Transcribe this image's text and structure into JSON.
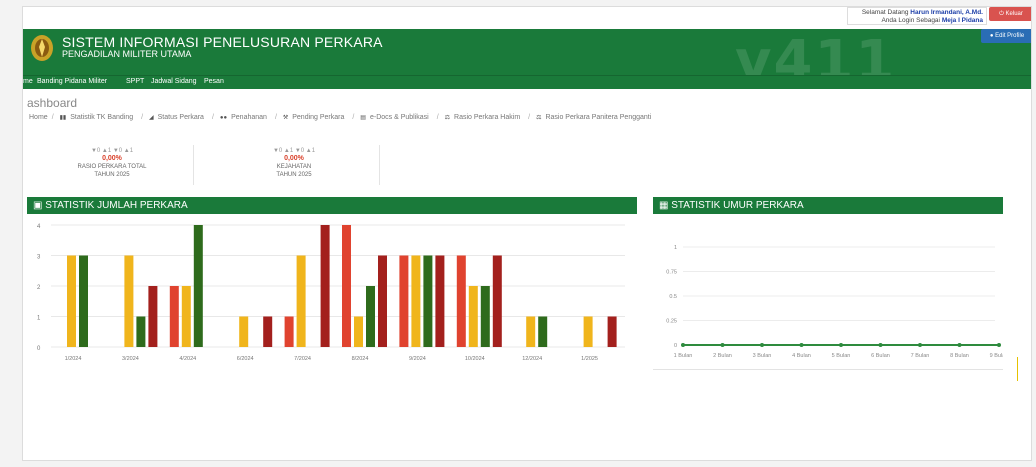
{
  "header": {
    "title": "SISTEM INFORMASI PENELUSURAN PERKARA",
    "subtitle": "PENGADILAN MILITER UTAMA",
    "watermark": "v411",
    "user_greeting": "Selamat Datang",
    "user_name": "Harun Irmandani, A.Md.",
    "login_as": "Anda Login Sebagai",
    "login_role": "Meja I Pidana",
    "logout_label": "Keluar",
    "profile_label": "Edit Profile"
  },
  "nav": {
    "items": [
      "me",
      "Banding Pidana Militer",
      "SPPT",
      "Jadwal Sidang",
      "Pesan"
    ]
  },
  "page": {
    "title": "ashboard",
    "breadcrumb": [
      "Home",
      "Statistik TK Banding",
      "Status Perkara",
      "Penahanan",
      "Pending Perkara",
      "e-Docs & Publikasi",
      "Rasio Perkara Hakim",
      "Rasio Perkara Panitera Pengganti"
    ]
  },
  "stats": [
    {
      "arrows": "▼0 ▲1 ▼0 ▲1",
      "pct": "0,00%",
      "label": "RASIO PERKARA TOTAL",
      "year": "TAHUN 2025"
    },
    {
      "arrows": "▼0 ▲1 ▼0 ▲1",
      "pct": "0,00%",
      "label": "KEJAHATAN",
      "year": "TAHUN 2025"
    }
  ],
  "panels": {
    "left_title": "STATISTIK JUMLAH PERKARA",
    "right_title": "STATISTIK UMUR PERKARA"
  },
  "colors": {
    "green_header": "#1a7a3a",
    "bar_red": "#e0432f",
    "bar_yellow": "#f0b51c",
    "bar_green": "#2e6b1c",
    "bar_darkred": "#a3201d"
  },
  "chart_data": [
    {
      "type": "bar",
      "title": "STATISTIK JUMLAH PERKARA",
      "ylim": [
        0,
        4
      ],
      "yticks": [
        "0",
        "1",
        "2",
        "3",
        "4"
      ],
      "grid": true,
      "series_colors": [
        "#e0432f",
        "#f0b51c",
        "#2e6b1c",
        "#a3201d"
      ],
      "groups": [
        {
          "label": "1/2024",
          "values": [
            null,
            3,
            3,
            null
          ]
        },
        {
          "label": "",
          "values": [
            null,
            3,
            1,
            2
          ]
        },
        {
          "label": "3/2024",
          "values": [
            2,
            2,
            4,
            null
          ]
        },
        {
          "label": "4/2024",
          "values": [
            null,
            1,
            null,
            1
          ]
        },
        {
          "label": "",
          "values": [
            1,
            3,
            null,
            4
          ]
        },
        {
          "label": "6/2024",
          "values": [
            4,
            1,
            2,
            3
          ]
        },
        {
          "label": "7/2024",
          "values": [
            3,
            3,
            3,
            3
          ]
        },
        {
          "label": "8/2024",
          "values": [
            3,
            2,
            2,
            3
          ]
        },
        {
          "label": "9/2024",
          "values": [
            null,
            1,
            1,
            null
          ]
        },
        {
          "label": "10/2024",
          "values": [
            null,
            1,
            null,
            1
          ]
        }
      ],
      "xticks": [
        "1/2024",
        "3/2024",
        "4/2024",
        "6/2024",
        "7/2024",
        "8/2024",
        "9/2024",
        "10/2024",
        "12/2024",
        "1/2025"
      ]
    },
    {
      "type": "line",
      "title": "STATISTIK UMUR PERKARA",
      "ylim": [
        0,
        1
      ],
      "yticks": [
        "0",
        "0.25",
        "0.5",
        "0.75",
        "1"
      ],
      "categories": [
        "1 Bulan",
        "2 Bulan",
        "3 Bulan",
        "4 Bulan",
        "5 Bulan",
        "6 Bulan",
        "7 Bulan",
        "8 Bulan",
        "9 Bulan"
      ],
      "values": [
        0,
        0,
        0,
        0,
        0,
        0,
        0,
        0,
        0
      ],
      "color": "#2e8b3e",
      "grid": true
    }
  ]
}
